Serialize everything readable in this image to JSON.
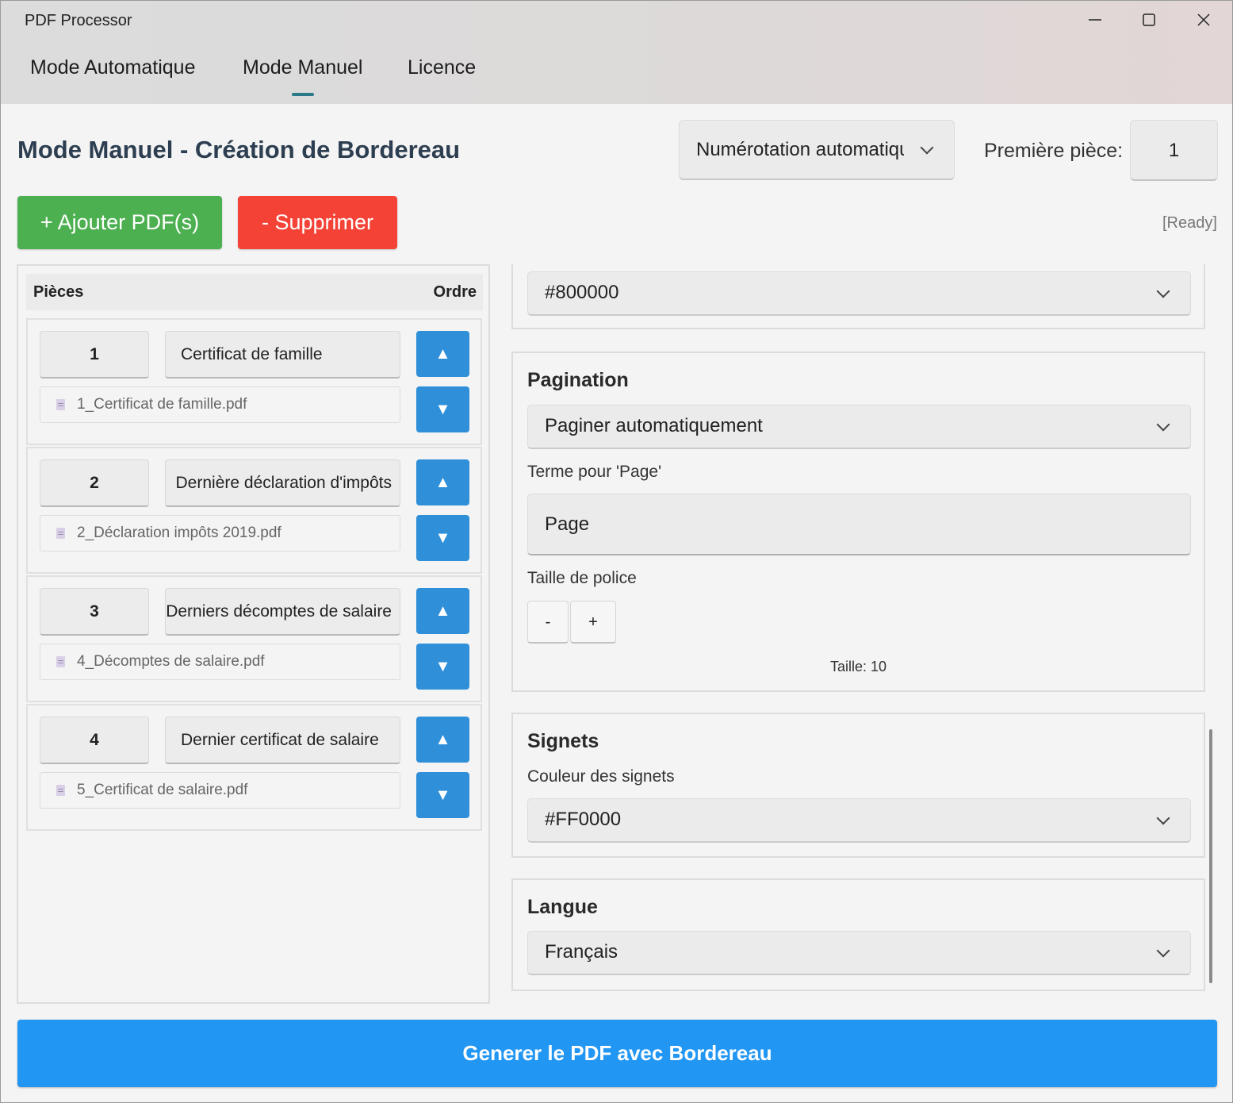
{
  "window": {
    "title": "PDF Processor",
    "minimize_icon": "minimize-icon",
    "maximize_icon": "maximize-icon",
    "close_icon": "close-icon"
  },
  "tabs": [
    {
      "label": "Mode Automatique",
      "active": false
    },
    {
      "label": "Mode Manuel",
      "active": true
    },
    {
      "label": "Licence",
      "active": false
    }
  ],
  "header": {
    "title": "Mode Manuel - Création de Bordereau",
    "numbering_select": "Numérotation automatique",
    "first_piece_label": "Première pièce:",
    "first_piece_value": "1"
  },
  "toolbar": {
    "add_label": "+ Ajouter PDF(s)",
    "delete_label": "- Supprimer",
    "status": "[Ready]"
  },
  "list": {
    "col_pieces": "Pièces",
    "col_order": "Ordre",
    "up_symbol": "▲",
    "down_symbol": "▼",
    "items": [
      {
        "number": "1",
        "title": "Certificat de famille",
        "file": "1_Certificat de famille.pdf"
      },
      {
        "number": "2",
        "title": "Dernière déclaration d'impôts",
        "file": "2_Déclaration impôts 2019.pdf"
      },
      {
        "number": "3",
        "title": "Derniers décomptes de salaire",
        "file": "4_Décomptes de salaire.pdf"
      },
      {
        "number": "4",
        "title": "Dernier certificat de salaire",
        "file": "5_Certificat de salaire.pdf"
      }
    ]
  },
  "settings": {
    "top_color_value": "#800000",
    "pagination": {
      "title": "Pagination",
      "mode": "Paginer automatiquement",
      "term_label": "Terme pour 'Page'",
      "term_value": "Page",
      "font_size_label": "Taille de police",
      "minus": "-",
      "plus": "+",
      "size_text": "Taille: 10"
    },
    "bookmarks": {
      "title": "Signets",
      "color_label": "Couleur des signets",
      "color_value": "#FF0000"
    },
    "language": {
      "title": "Langue",
      "value": "Français"
    }
  },
  "generate_label": "Generer le PDF avec Bordereau",
  "colors": {
    "add_button": "#4caf50",
    "delete_button": "#f44336",
    "arrow_button": "#2f8fd8",
    "generate_button": "#2196f3",
    "title_text": "#2c3e50"
  }
}
